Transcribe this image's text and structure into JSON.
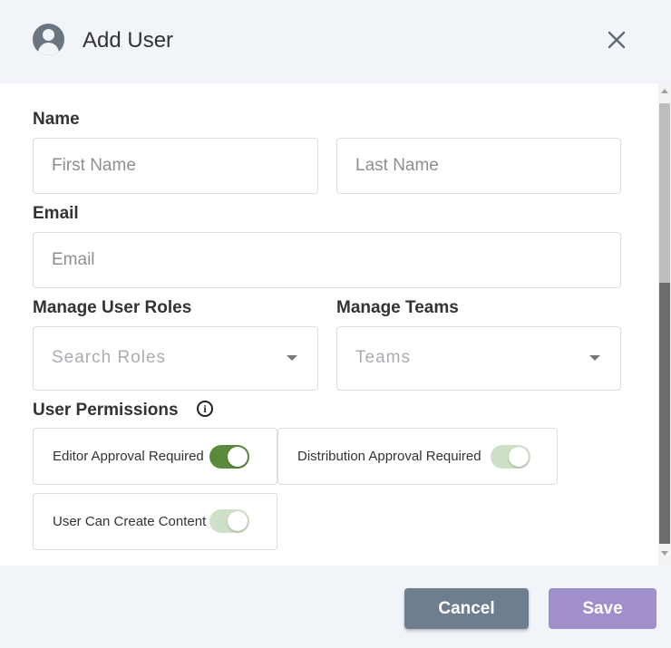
{
  "dialog": {
    "title": "Add User",
    "icon": "user-circle-icon",
    "close_icon": "close-icon"
  },
  "form": {
    "name_label": "Name",
    "first_name": {
      "placeholder": "First Name",
      "value": ""
    },
    "last_name": {
      "placeholder": "Last Name",
      "value": ""
    },
    "email_label": "Email",
    "email": {
      "placeholder": "Email",
      "value": ""
    },
    "roles_label": "Manage User Roles",
    "roles_placeholder": "Search Roles",
    "teams_label": "Manage Teams",
    "teams_placeholder": "Teams",
    "permissions_label": "User Permissions",
    "permissions": [
      {
        "label": "Editor Approval Required",
        "enabled": true,
        "style": "active"
      },
      {
        "label": "Distribution Approval Required",
        "enabled": true,
        "style": "disabled"
      },
      {
        "label": "User Can Create Content",
        "enabled": true,
        "style": "disabled"
      }
    ]
  },
  "footer": {
    "cancel_label": "Cancel",
    "save_label": "Save"
  },
  "colors": {
    "header_bg": "#f1f4f9",
    "toggle_on": "#5a8a3c",
    "toggle_disabled": "#cfe0c8",
    "cancel_bg": "#6d7f8f",
    "save_bg": "#a08fcb"
  }
}
